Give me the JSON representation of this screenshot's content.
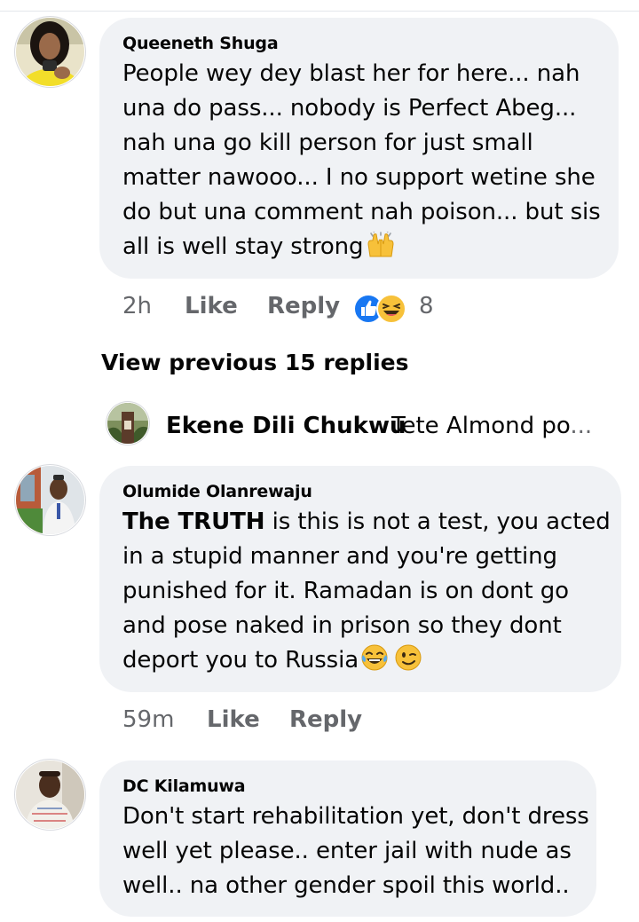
{
  "comments": [
    {
      "author": "Queeneth Shuga",
      "lines": [
        "People wey dey blast her for here... nah",
        "una do pass... nobody is Perfect Abeg...",
        "nah una go kill person for just small",
        "matter nawooo... I no support wetine she",
        "do but una comment nah poison... but sis",
        "all is well stay strong"
      ],
      "time": "2h",
      "like_label": "Like",
      "reply_label": "Reply",
      "reaction_count": "8",
      "reaction_icons": [
        "like-icon",
        "laugh-emoji-icon"
      ],
      "trailing_emoji": "raised-hands-emoji"
    },
    {
      "view_previous": "View previous 15 replies",
      "collapsed_author": "Ekene Dili Chukwu",
      "collapsed_preview": "Tete Almond po",
      "collapsed_ellipsis": "..."
    },
    {
      "author": "Olumide Olanrewaju",
      "bold_prefix": "The TRUTH",
      "lines": [
        " is this is not a test, you acted",
        "in a stupid manner and you're getting",
        "punished for it. Ramadan is on dont go",
        "and pose naked in prison so they dont",
        "deport you to Russia"
      ],
      "time": "59m",
      "like_label": "Like",
      "reply_label": "Reply",
      "trailing_emojis": [
        "tears-of-joy-emoji",
        "wink-emoji"
      ]
    },
    {
      "author": "DC Kilamuwa",
      "lines": [
        "Don't start rehabilitation yet, don't dress",
        "well yet please.. enter jail with nude as",
        "well.. na other gender spoil this world.."
      ]
    }
  ],
  "colors": {
    "bubble": "#f0f2f5",
    "meta_text": "#65676b",
    "like_blue": "#1877f2",
    "text": "#050505"
  }
}
